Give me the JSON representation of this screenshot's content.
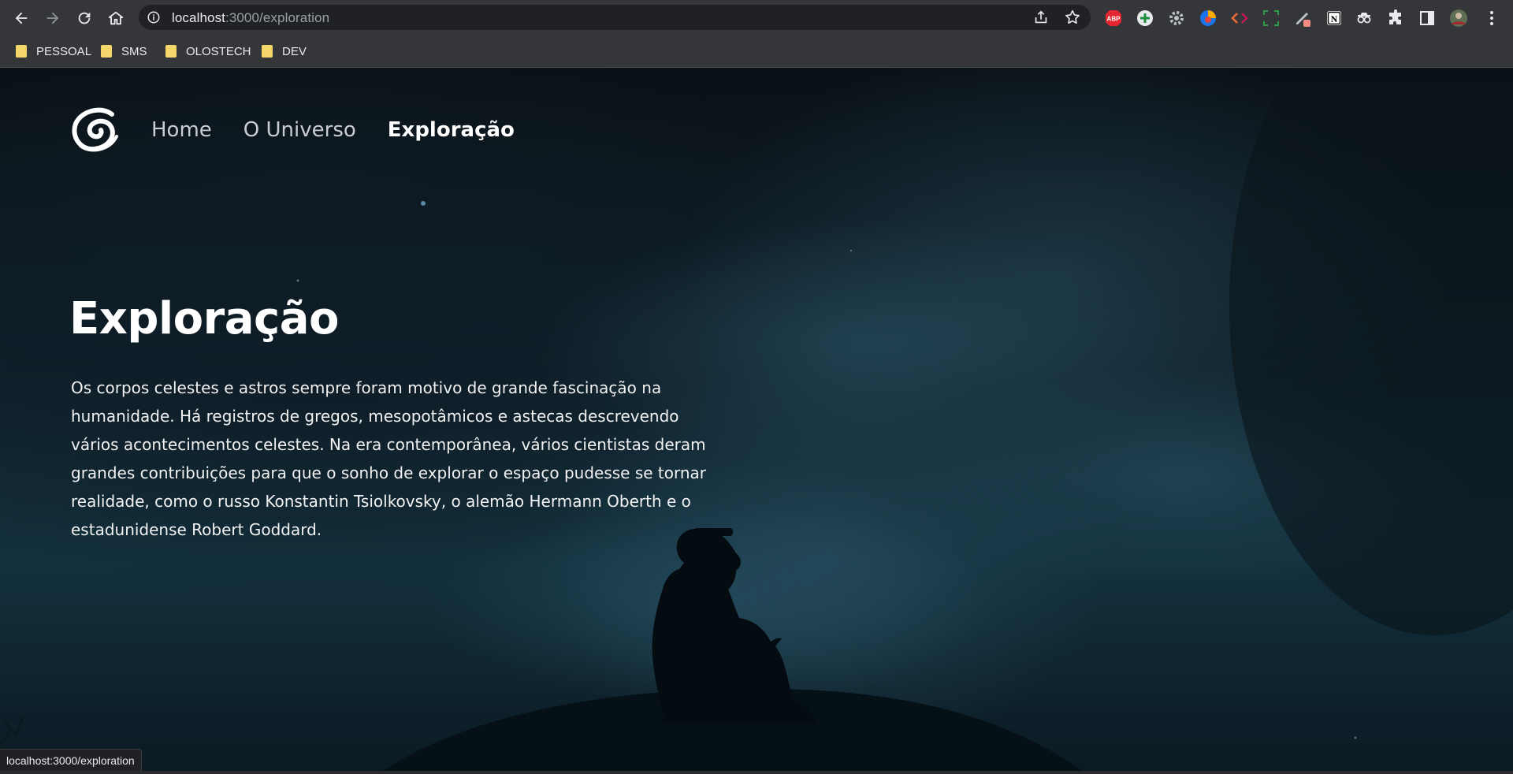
{
  "browser": {
    "url_host": "localhost",
    "url_path": ":3000/exploration",
    "bookmarks": [
      {
        "label": "PESSOAL"
      },
      {
        "label": "SMS"
      },
      {
        "label": "OLOSTECH"
      },
      {
        "label": "DEV"
      }
    ],
    "status_url": "localhost:3000/exploration",
    "extensions": [
      "adblock-icon",
      "plus-extension-icon",
      "settings-extension-icon",
      "color-extension-icon",
      "code-extension-icon",
      "screenshot-extension-icon",
      "pen-extension-icon",
      "notion-icon",
      "incognito-extension-icon",
      "puzzle-icon",
      "side-panel-icon",
      "profile-avatar",
      "menu-icon"
    ],
    "ext_labels": {
      "adblock": "ABP",
      "notion": "N"
    }
  },
  "site": {
    "nav": [
      {
        "label": "Home"
      },
      {
        "label": "O Universo"
      },
      {
        "label": "Exploração"
      }
    ],
    "title": "Exploração",
    "body_lines": [
      "Os corpos celestes e astros sempre foram motivo de grande fascinação na",
      "humanidade. Há registros de gregos, mesopotâmicos e astecas descrevendo",
      "vários acontecimentos celestes. Na era contemporânea, vários cientistas deram",
      "grandes contribuições para que o sonho de explorar o espaço pudesse se tornar",
      "realidade, como o russo Konstantin Tsiolkovsky, o alemão Hermann Oberth e o",
      "estadunidense Robert Goddard."
    ]
  },
  "colors": {
    "chrome_bg": "#35363a",
    "omnibox_bg": "#202124",
    "page_sky": "#13303d",
    "text_white": "#ffffff"
  }
}
